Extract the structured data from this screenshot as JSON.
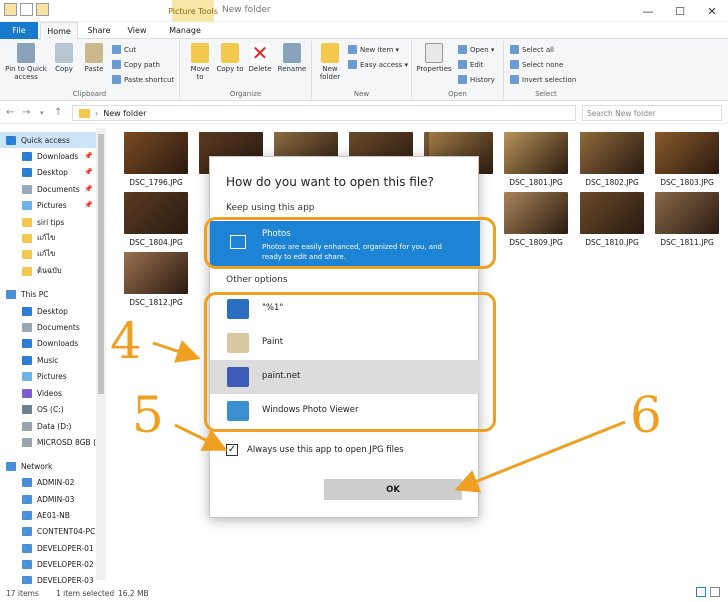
{
  "window": {
    "title": "New folder",
    "context_tab": "Picture Tools",
    "minimize": "—",
    "maximize": "☐",
    "close": "✕"
  },
  "tabs": [
    {
      "label": "File"
    },
    {
      "label": "Home"
    },
    {
      "label": "Share"
    },
    {
      "label": "View"
    },
    {
      "label": "Manage"
    }
  ],
  "ribbon": {
    "clipboard": {
      "name": "Clipboard",
      "pin": "Pin to Quick access",
      "copy": "Copy",
      "paste": "Paste",
      "cut": "Cut",
      "copy_path": "Copy path",
      "paste_shortcut": "Paste shortcut"
    },
    "organize": {
      "name": "Organize",
      "move_to": "Move to",
      "copy_to": "Copy to",
      "delete": "Delete",
      "rename": "Rename"
    },
    "new": {
      "name": "New",
      "new_folder": "New folder",
      "new_item": "New item ▾",
      "easy_access": "Easy access ▾"
    },
    "open": {
      "name": "Open",
      "properties": "Properties",
      "open": "Open ▾",
      "edit": "Edit",
      "history": "History"
    },
    "select": {
      "name": "Select",
      "select_all": "Select all",
      "select_none": "Select none",
      "invert": "Invert selection"
    }
  },
  "address": {
    "path": "New folder",
    "search_placeholder": "Search New folder"
  },
  "sidebar": {
    "items": [
      {
        "label": "Quick access",
        "icon": "star-icon",
        "color": "#2a7fd4"
      },
      {
        "label": "Downloads",
        "icon": "download-icon",
        "color": "#2a7fd4",
        "pin": "📌"
      },
      {
        "label": "Desktop",
        "icon": "desktop-icon",
        "color": "#2a7fd4",
        "pin": "📌"
      },
      {
        "label": "Documents",
        "icon": "documents-icon",
        "color": "#9aa7b4",
        "pin": "📌"
      },
      {
        "label": "Pictures",
        "icon": "pictures-icon",
        "color": "#6db3e8",
        "pin": "📌"
      },
      {
        "label": "siri tips",
        "icon": "folder-icon",
        "color": "#f2c94c"
      },
      {
        "label": "แก้ไข",
        "icon": "folder-icon",
        "color": "#f2c94c"
      },
      {
        "label": "แก้ไข",
        "icon": "folder-icon",
        "color": "#f2c94c"
      },
      {
        "label": "ต้นฉบับ",
        "icon": "folder-icon",
        "color": "#f2c94c"
      },
      {
        "label": "This PC",
        "icon": "pc-icon",
        "color": "#4a90d9"
      },
      {
        "label": "Desktop",
        "icon": "desktop-icon",
        "color": "#2a7fd4"
      },
      {
        "label": "Documents",
        "icon": "documents-icon",
        "color": "#9aa7b4"
      },
      {
        "label": "Downloads",
        "icon": "download-icon",
        "color": "#2a7fd4"
      },
      {
        "label": "Music",
        "icon": "music-icon",
        "color": "#2a7fd4"
      },
      {
        "label": "Pictures",
        "icon": "pictures-icon",
        "color": "#6db3e8"
      },
      {
        "label": "Videos",
        "icon": "videos-icon",
        "color": "#7a5fd0"
      },
      {
        "label": "OS (C:)",
        "icon": "drive-icon",
        "color": "#6e7f8f"
      },
      {
        "label": "Data (D:)",
        "icon": "drive-icon",
        "color": "#9aa3ab"
      },
      {
        "label": "MICROSD 8GB (F",
        "icon": "drive-icon",
        "color": "#9aa3ab"
      },
      {
        "label": "Network",
        "icon": "network-icon",
        "color": "#4a90d9"
      },
      {
        "label": "ADMIN-02",
        "icon": "computer-icon",
        "color": "#4a90d9"
      },
      {
        "label": "ADMIN-03",
        "icon": "computer-icon",
        "color": "#4a90d9"
      },
      {
        "label": "AE01-NB",
        "icon": "computer-icon",
        "color": "#4a90d9"
      },
      {
        "label": "CONTENT04-PC",
        "icon": "computer-icon",
        "color": "#4a90d9"
      },
      {
        "label": "DEVELOPER-01",
        "icon": "computer-icon",
        "color": "#4a90d9"
      },
      {
        "label": "DEVELOPER-02",
        "icon": "computer-icon",
        "color": "#4a90d9"
      },
      {
        "label": "DEVELOPER-03",
        "icon": "computer-icon",
        "color": "#4a90d9"
      }
    ]
  },
  "files": [
    {
      "name": "DSC_1796.JPG",
      "color": "#7a4a22"
    },
    {
      "name": "",
      "color": "#5a3a20"
    },
    {
      "name": "",
      "color": "#8a6a40"
    },
    {
      "name": "",
      "color": "#6a4a2a"
    },
    {
      "name": "",
      "color": "#7a5a30"
    },
    {
      "name": "",
      "color": "#a07a45"
    },
    {
      "name": "DSC_1801.JPG",
      "color": "#b9935a"
    },
    {
      "name": "DSC_1802.JPG",
      "color": "#8e6a3c"
    },
    {
      "name": "DSC_1803.JPG",
      "color": "#8a5a2a"
    },
    {
      "name": "DSC_1804.JPG",
      "color": "#5a3a22"
    },
    {
      "name": "DSC_1809.JPG",
      "color": "#a9855a"
    },
    {
      "name": "DSC_1810.JPG",
      "color": "#6a4a2a"
    },
    {
      "name": "DSC_1811.JPG",
      "color": "#8a6a4a"
    },
    {
      "name": "DSC_1812.JPG",
      "color": "#9a7050"
    }
  ],
  "status": {
    "items": "17 items",
    "selected": "1 item selected",
    "size": "16.2 MB"
  },
  "dialog": {
    "title": "How do you want to open this file?",
    "keep": "Keep using this app",
    "photos_name": "Photos",
    "photos_desc": "Photos are easily enhanced, organized for you, and ready to edit and share.",
    "other": "Other options",
    "options": [
      {
        "label": "\"%1\"",
        "color": "#2a6fc0"
      },
      {
        "label": "Paint",
        "color": "#d8c9a0"
      },
      {
        "label": "paint.net",
        "color": "#3b5cb8"
      },
      {
        "label": "Windows Photo Viewer",
        "color": "#3a8fd0"
      }
    ],
    "always": "Always use this app to open JPG files",
    "always_checked": true,
    "check_mark": "✓",
    "ok": "OK"
  },
  "annotations": {
    "n4": "4",
    "n5": "5",
    "n6": "6",
    "color": "#f0a020"
  }
}
